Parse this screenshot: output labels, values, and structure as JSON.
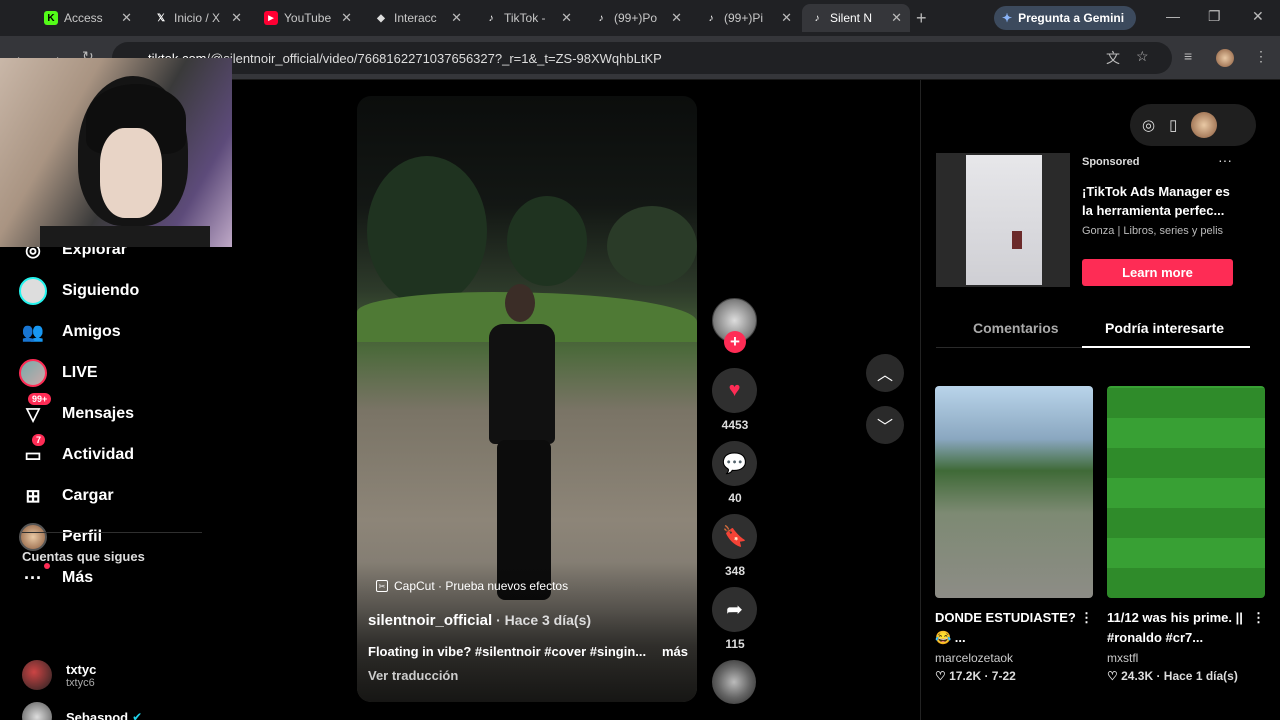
{
  "browser": {
    "tabs": [
      {
        "title": "Access",
        "icon": "kick-icon",
        "color": "#53fc18"
      },
      {
        "title": "Inicio / X",
        "icon": "x-icon",
        "color": "#ffffff"
      },
      {
        "title": "YouTube",
        "icon": "youtube-icon",
        "color": "#ff0033"
      },
      {
        "title": "Interacc",
        "icon": "diamond-icon",
        "color": "#dddddd"
      },
      {
        "title": "TikTok -",
        "icon": "tiktok-icon",
        "color": "#ffffff"
      },
      {
        "title": "(99+)Po",
        "icon": "tiktok-icon",
        "color": "#ffffff"
      },
      {
        "title": "(99+)Pi",
        "icon": "tiktok-icon",
        "color": "#ffffff"
      },
      {
        "title": "Silent N",
        "icon": "tiktok-icon",
        "color": "#ffffff"
      }
    ],
    "gemini_button": "Pregunta a Gemini",
    "url_host": "tiktok.com",
    "url_path": "/@silentnoir_official/video/7668162271037656327?_r=1&_t=ZS-98XWqhbLtKP"
  },
  "sidebar": {
    "items": [
      {
        "label": "Explorar",
        "icon": "compass-icon"
      },
      {
        "label": "Siguiendo",
        "icon": "following-icon"
      },
      {
        "label": "Amigos",
        "icon": "friends-icon"
      },
      {
        "label": "LIVE",
        "icon": "live-icon"
      },
      {
        "label": "Mensajes",
        "icon": "messages-icon",
        "badge": "99+"
      },
      {
        "label": "Actividad",
        "icon": "activity-icon",
        "badge": "7"
      },
      {
        "label": "Cargar",
        "icon": "upload-icon"
      },
      {
        "label": "Perfil",
        "icon": "profile-icon"
      },
      {
        "label": "Más",
        "icon": "more-icon"
      }
    ],
    "following_title": "Cuentas que sigues",
    "following": [
      {
        "name": "txtyc",
        "handle": "txtyc6"
      },
      {
        "name": "Sebaspod",
        "handle": ""
      }
    ]
  },
  "video": {
    "effect_label": "CapCut · Prueba nuevos efectos",
    "author": "silentnoir_official",
    "time": " · Hace 3 día(s)",
    "caption": "Floating in vibe? #silentnoir #cover #singin...",
    "more": "más",
    "translate": "Ver traducción",
    "likes": "4453",
    "comments": "40",
    "saves": "348",
    "shares": "115",
    "brand_color": "#fe2c55"
  },
  "right_panel": {
    "ad": {
      "sponsored": "Sponsored",
      "headline": "¡TikTok Ads Manager es la herramienta perfec...",
      "brand": "Gonza | Libros, series y pelis",
      "cta": "Learn more"
    },
    "tabs": [
      "Comentarios",
      "Podría interesarte"
    ],
    "recommendations": [
      {
        "title": "DONDE ESTUDIASTE? 😂 ...",
        "author": "marcelozetaok",
        "likes": "17.2K",
        "date": "7-22"
      },
      {
        "title": "11/12 was his prime. || #ronaldo #cr7...",
        "author": "mxstfl",
        "likes": "24.3K",
        "date": "Hace 1 día(s)"
      }
    ]
  }
}
